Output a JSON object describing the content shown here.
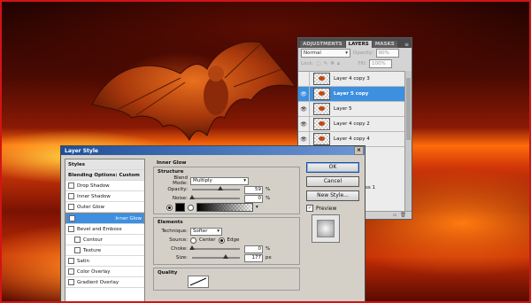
{
  "layers_panel": {
    "tabs": [
      "ADJUSTMENTS",
      "LAYERS",
      "MASKS"
    ],
    "blend_mode": "Normal",
    "opacity_label": "Opacity:",
    "opacity_value": "90%",
    "lock_label": "Lock:",
    "fill_label": "Fill:",
    "fill_value": "100%",
    "layers": [
      {
        "name": "Layer 4 copy 3",
        "visible": false,
        "active": false
      },
      {
        "name": "Layer 5 copy",
        "visible": true,
        "active": true
      },
      {
        "name": "Layer 5",
        "visible": true,
        "active": false
      },
      {
        "name": "Layer 4 copy 2",
        "visible": true,
        "active": false
      },
      {
        "name": "Layer 4 copy 4",
        "visible": true,
        "active": false
      }
    ],
    "partial_label": "ss 1"
  },
  "dialog": {
    "title": "Layer Style",
    "left_list": {
      "styles": "Styles",
      "blending": "Blending Options: Custom",
      "items": [
        {
          "label": "Drop Shadow",
          "checked": false,
          "selected": false,
          "sub": false
        },
        {
          "label": "Inner Shadow",
          "checked": false,
          "selected": false,
          "sub": false
        },
        {
          "label": "Outer Glow",
          "checked": false,
          "selected": false,
          "sub": false
        },
        {
          "label": "Inner Glow",
          "checked": true,
          "selected": true,
          "sub": false
        },
        {
          "label": "Bevel and Emboss",
          "checked": false,
          "selected": false,
          "sub": false
        },
        {
          "label": "Contour",
          "checked": false,
          "selected": false,
          "sub": true
        },
        {
          "label": "Texture",
          "checked": false,
          "selected": false,
          "sub": true
        },
        {
          "label": "Satin",
          "checked": false,
          "selected": false,
          "sub": false
        },
        {
          "label": "Color Overlay",
          "checked": false,
          "selected": false,
          "sub": false
        },
        {
          "label": "Gradient Overlay",
          "checked": false,
          "selected": false,
          "sub": false
        }
      ]
    },
    "inner_glow": {
      "section_title": "Inner Glow",
      "structure_title": "Structure",
      "blend_mode_label": "Blend Mode:",
      "blend_mode_value": "Multiply",
      "opacity_label": "Opacity:",
      "opacity_value": "59",
      "opacity_level": 0.59,
      "noise_label": "Noise:",
      "noise_value": "0",
      "noise_level": 0,
      "percent": "%",
      "elements_title": "Elements",
      "technique_label": "Technique:",
      "technique_value": "Softer",
      "source_label": "Source:",
      "source_center": "Center",
      "source_edge": "Edge",
      "choke_label": "Choke:",
      "choke_value": "0",
      "choke_level": 0,
      "size_label": "Size:",
      "size_value": "177",
      "size_level": 0.7,
      "px": "px",
      "quality_title": "Quality"
    },
    "buttons": {
      "ok": "OK",
      "cancel": "Cancel",
      "new_style": "New Style...",
      "preview": "Preview"
    }
  }
}
